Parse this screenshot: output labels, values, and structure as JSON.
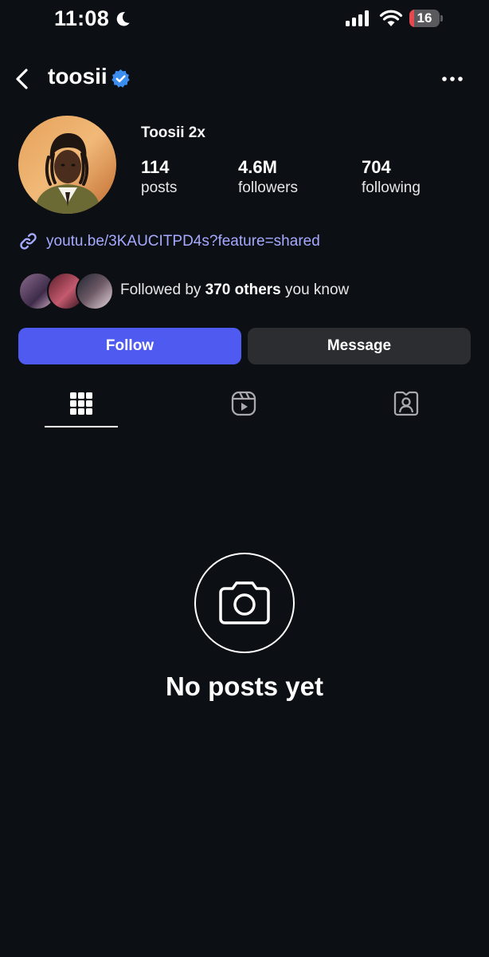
{
  "status_bar": {
    "time": "11:08",
    "battery_level": "16",
    "battery_fraction": 0.16,
    "icons": [
      "moon-icon",
      "cellular-signal-icon",
      "wifi-icon",
      "battery-icon"
    ]
  },
  "header": {
    "username": "toosii",
    "verified": true,
    "icons": [
      "back-chevron-icon",
      "verified-badge-icon",
      "more-options-icon"
    ]
  },
  "profile": {
    "display_name": "Toosii 2x",
    "stats": [
      {
        "value": "114",
        "label": "posts"
      },
      {
        "value": "4.6M",
        "label": "followers"
      },
      {
        "value": "704",
        "label": "following"
      }
    ],
    "link": "youtu.be/3KAUCITPD4s?feature=shared",
    "mutual": {
      "prefix": "Followed by",
      "count": "370 others",
      "suffix": "you know"
    }
  },
  "actions": {
    "follow_label": "Follow",
    "message_label": "Message"
  },
  "tabs": [
    {
      "name": "posts-grid",
      "icon": "grid-icon",
      "active": true
    },
    {
      "name": "reels",
      "icon": "reels-icon",
      "active": false
    },
    {
      "name": "tagged",
      "icon": "tagged-person-icon",
      "active": false
    }
  ],
  "empty_state": {
    "icon": "camera-icon",
    "text": "No posts yet"
  },
  "colors": {
    "background": "#0c0f14",
    "follow_button": "#4f5bf0",
    "message_button": "#2b2d31",
    "link": "#a5aaff",
    "verified": "#3b8df0",
    "battery_low": "#e5484d"
  }
}
